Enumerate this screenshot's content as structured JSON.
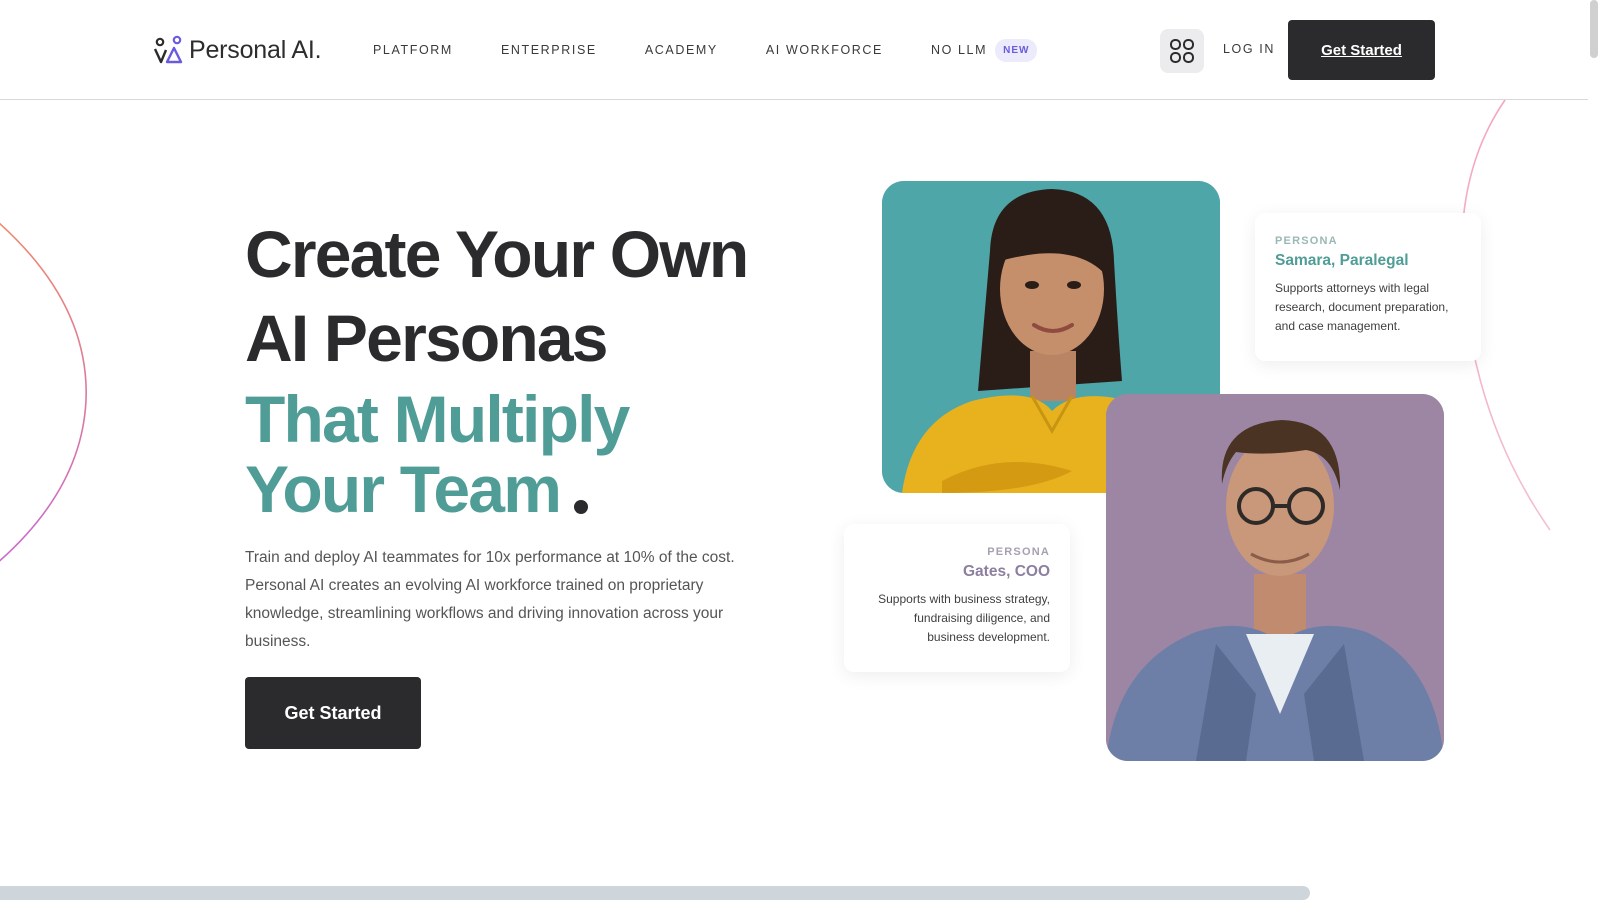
{
  "brand": {
    "name": "Personal AI.",
    "accent": "#4f9d96",
    "dark": "#2b2b2d",
    "purple": "#6a5ae0"
  },
  "nav": {
    "items": [
      {
        "label": "PLATFORM"
      },
      {
        "label": "ENTERPRISE"
      },
      {
        "label": "ACADEMY"
      },
      {
        "label": "AI WORKFORCE"
      },
      {
        "label": "NO LLM",
        "badge": "NEW"
      }
    ],
    "apps_icon": "apps-grid-icon",
    "login": "LOG IN",
    "cta": "Get Started"
  },
  "hero": {
    "title_line1": "Create Your Own",
    "title_line2": "AI Personas",
    "title_line3": "That Multiply",
    "title_line4": "Your Team",
    "description": "Train and deploy AI teammates for 10x performance at 10% of the cost. Personal AI creates an evolving AI workforce trained on proprietary knowledge, streamlining workflows and driving innovation across your business.",
    "cta": "Get Started"
  },
  "personas": [
    {
      "label": "PERSONA",
      "name": "Samara, Paralegal",
      "description": "Supports attorneys with legal research, document preparation, and case management."
    },
    {
      "label": "PERSONA",
      "name": "Gates, COO",
      "description": "Supports with business strategy, fundraising diligence, and business development."
    }
  ]
}
